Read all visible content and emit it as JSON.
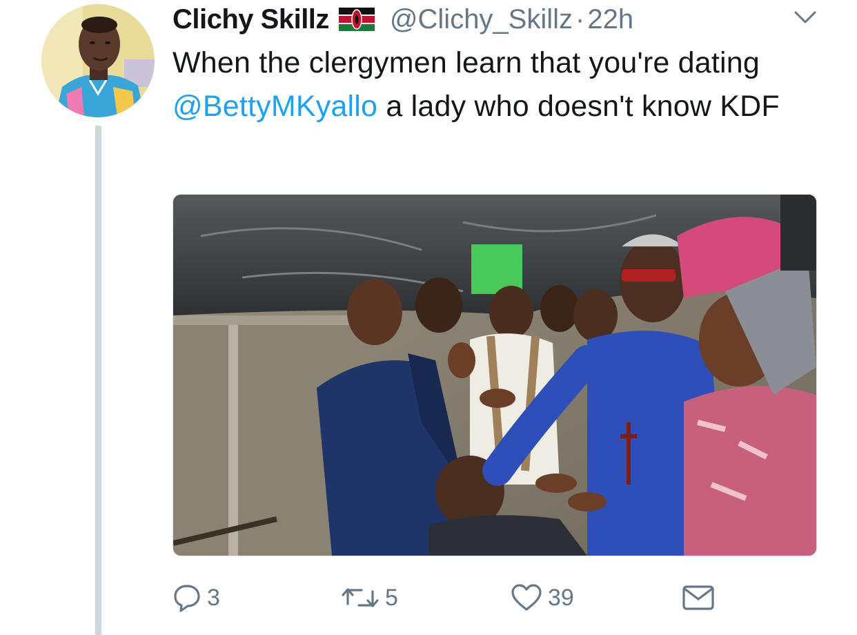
{
  "tweet": {
    "display_name": "Clichy Skillz",
    "handle": "@Clichy_Skillz",
    "separator": "·",
    "timestamp": "22h",
    "text_part1": "When the clergymen learn that you're dating ",
    "mention": "@BettyMKyallo",
    "text_part2": "  a lady who doesn't know KDF"
  },
  "actions": {
    "replies": "3",
    "retweets": "5",
    "likes": "39"
  },
  "icons": {
    "flag": "kenya-flag-icon",
    "menu": "chevron-down-icon",
    "reply": "reply-icon",
    "retweet": "retweet-icon",
    "like": "heart-icon",
    "message": "envelope-icon"
  },
  "colors": {
    "text": "#14171a",
    "secondary": "#657786",
    "link": "#1da1f2",
    "thread_line": "#ccd6dd"
  }
}
